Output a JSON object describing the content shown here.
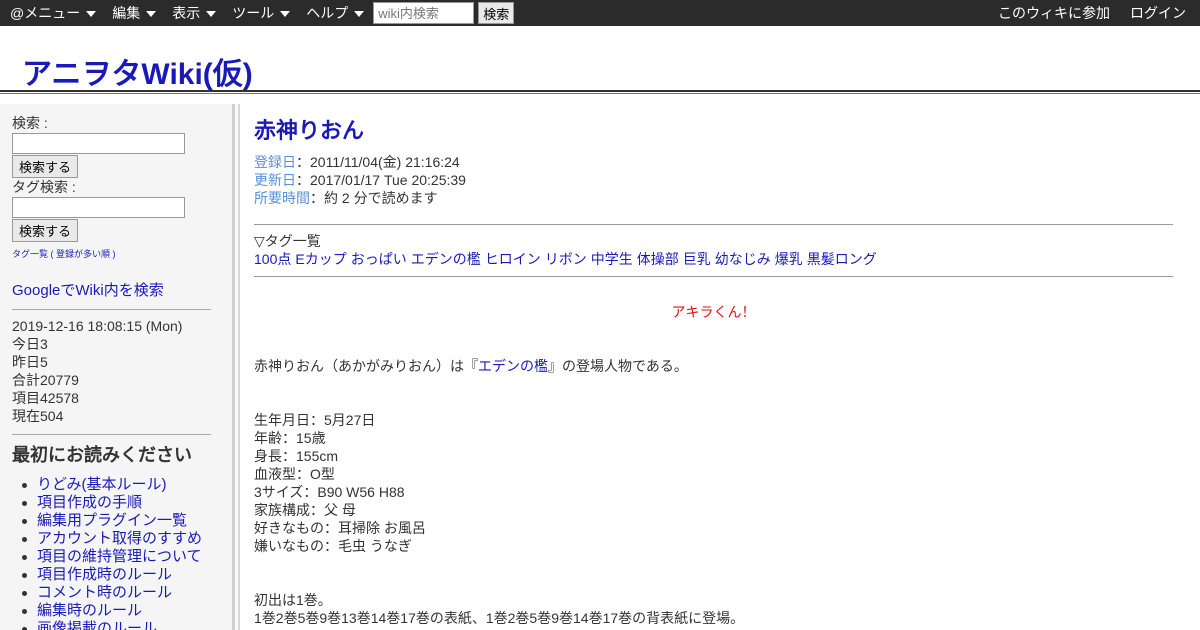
{
  "topbar": {
    "menu": [
      {
        "label": "@メニュー"
      },
      {
        "label": "編集"
      },
      {
        "label": "表示"
      },
      {
        "label": "ツール"
      },
      {
        "label": "ヘルプ"
      }
    ],
    "search_placeholder": "wiki内検索",
    "search_button": "検索",
    "join": "このウィキに参加",
    "login": "ログイン"
  },
  "header": {
    "title": "アニヲタWiki(仮)"
  },
  "sidebar": {
    "search_label": "検索 :",
    "search_button": "検索する",
    "tag_search_label": "タグ検索 :",
    "tag_search_button": "検索する",
    "tag_list_link": "タグ一覧 ( 登録が多い順 )",
    "google_search": "GoogleでWiki内を検索",
    "stats": {
      "datetime": "2019-12-16 18:08:15 (Mon)",
      "today": "今日3",
      "yesterday": "昨日5",
      "total": "合計20779",
      "items": "項目42578",
      "current": "現在504"
    },
    "read_first_heading": "最初にお読みください",
    "read_first_items": [
      "りどみ(基本ルール)",
      "項目作成の手順",
      "編集用プラグイン一覧",
      "アカウント取得のすすめ",
      "項目の維持管理について",
      "項目作成時のルール",
      "コメント時のルール",
      "編集時のルール",
      "画像掲載のルール"
    ]
  },
  "main": {
    "title": "赤神りおん",
    "meta": {
      "registered_key": "登録日",
      "registered_val": "：2011/11/04(金) 21:16:24",
      "updated_key": "更新日",
      "updated_val": "：2017/01/17 Tue 20:25:39",
      "time_key": "所要時間",
      "time_val": "：約 2 分で読めます"
    },
    "tags_heading": "▽タグ一覧",
    "tags": [
      "100点",
      "Eカップ",
      "おっぱい",
      "エデンの檻",
      "ヒロイン",
      "リボン",
      "中学生",
      "体操部",
      "巨乳",
      "幼なじみ",
      "爆乳",
      "黒髪ロング"
    ],
    "quote": "アキラくん！",
    "intro_before": "赤神りおん（あかがみりおん）は『",
    "intro_link": "エデンの檻",
    "intro_after": "』の登場人物である。",
    "profile": [
      "生年月日：5月27日",
      "年齢：15歳",
      "身長：155cm",
      "血液型：O型",
      "3サイズ：B90 W56 H88",
      "家族構成：父 母",
      "好きなもの：耳掃除 お風呂",
      "嫌いなもの：毛虫 うなぎ"
    ],
    "first_appearance": "初出は1巻。",
    "covers": "1巻2巻5巻9巻13巻14巻17巻の表紙、1巻2巻5巻9巻14巻17巻の背表紙に登場。"
  }
}
